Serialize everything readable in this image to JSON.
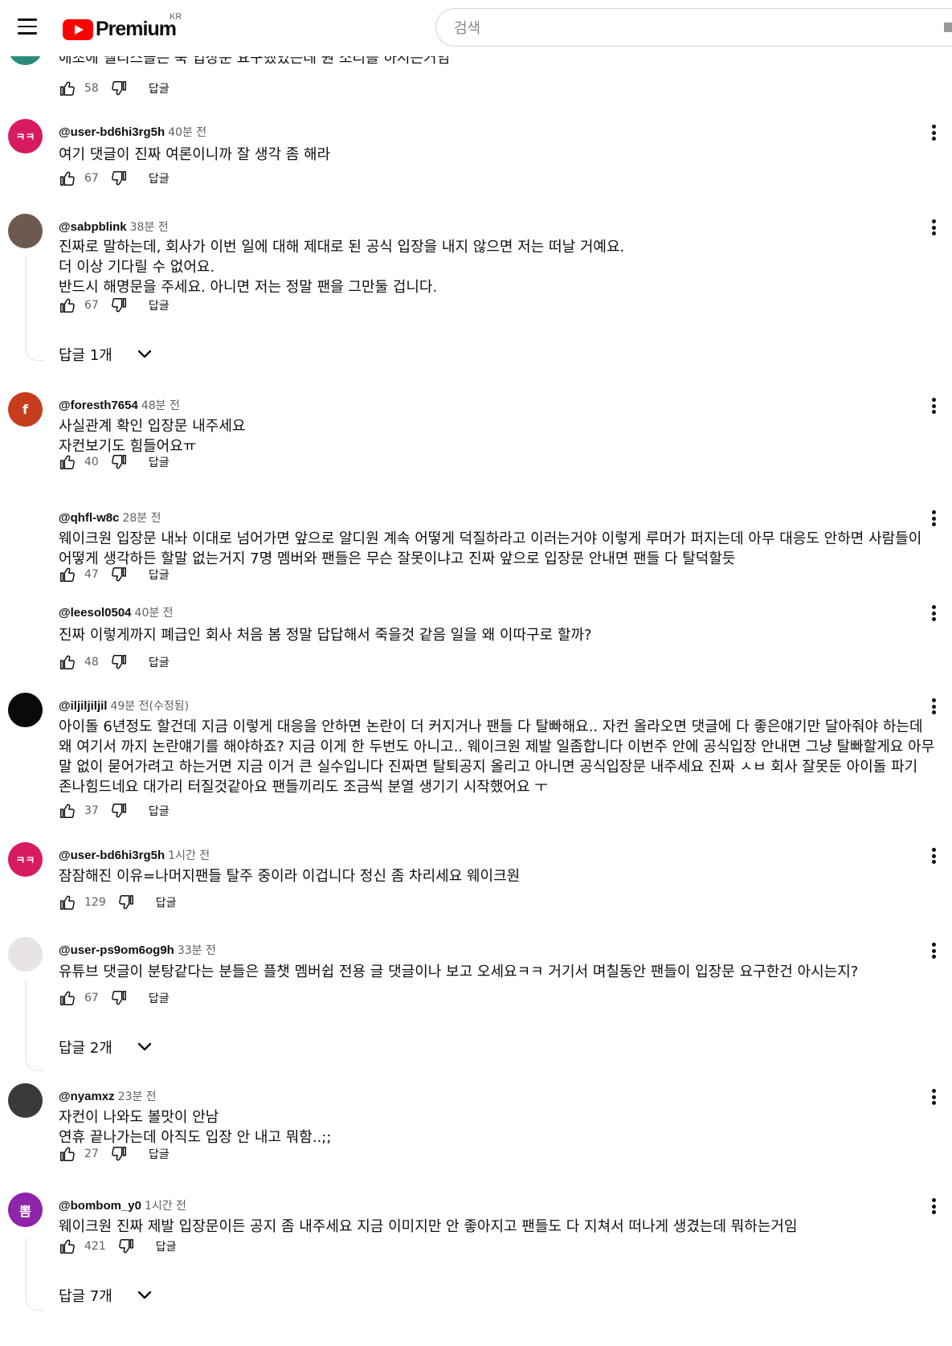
{
  "header": {
    "logo_text": "Premium",
    "region": "KR",
    "search_placeholder": "검색"
  },
  "reply_label": "답글",
  "top_partial": {
    "text": "애초에 멜리스들은 쭉 입장문 요구했었는데 뭔 소리를 하시는거임",
    "likes": "58"
  },
  "comments": [
    {
      "author": "@user-bd6hi3rg5h",
      "time": "40분 전",
      "avatar_text": "ㅋㅋ",
      "avatar_color": "#d81b60",
      "lines": [
        "여기 댓글이 진짜 여론이니까 잘 생각 좀 해라"
      ],
      "likes": "67"
    },
    {
      "author": "@sabpblink",
      "time": "38분 전",
      "avatar_text": "",
      "avatar_color": "#6d5a4e",
      "lines": [
        "진짜로 말하는데, 회사가 이번 일에 대해 제대로 된 공식 입장을 내지 않으면 저는 떠날 거예요.",
        "더 이상 기다릴 수 없어요.",
        "반드시 해명문을 주세요. 아니면 저는 정말 팬을 그만둘 겁니다."
      ],
      "likes": "67",
      "replies": "답글 1개"
    },
    {
      "author": "@foresth7654",
      "time": "48분 전",
      "avatar_text": "f",
      "avatar_color": "#c63d1e",
      "lines": [
        "사실관계 확인 입장문 내주세요",
        "자컨보기도 힘들어요ㅠ"
      ],
      "likes": "40"
    },
    {
      "author": "@qhfl-w8c",
      "time": "28분 전",
      "lines": [
        "웨이크원 입장문 내놔 이대로 넘어가면 앞으로 알디원 계속 어떻게 덕질하라고 이러는거야 이렇게 루머가 퍼지는데 아무 대응도 안하면 사람들이",
        "어떻게 생각하든 할말 없는거지 7명 멤버와 팬들은 무슨 잘못이냐고 진짜 앞으로 입장문 안내면 팬들 다 탈덕할듯"
      ],
      "likes": "47"
    },
    {
      "author": "@leesol0504",
      "time": "40분 전",
      "lines": [
        "진짜 이렇게까지 폐급인 회사 처음 봄 정말 답답해서 죽을것 같음 일을 왜 이따구로 할까?"
      ],
      "likes": "48"
    },
    {
      "author": "@iljiljiljil",
      "time": "49분 전(수정됨)",
      "avatar_text": "",
      "avatar_color": "#0a0a0a",
      "lines": [
        "아이돌 6년정도 할건데 지금 이렇게 대응을 안하면 논란이 더 커지거나 팬들 다 탈빠해요.. 자컨 올라오면 댓글에 다 좋은얘기만 달아줘야 하는데",
        "왜 여기서 까지 논란얘기를 해야하죠? 지금 이게 한 두번도 아니고.. 웨이크원 제발 일좀합니다 이번주 안에 공식입장 안내면 그냥 탈빠할게요 아무",
        "말 없이 묻어가려고 하는거면 지금 이거 큰 실수입니다 진짜면 탈퇴공지 올리고 아니면 공식입장문 내주세요 진짜 ㅅㅂ 회사 잘못둔 아이돌 파기",
        "존나힘드네요 대가리 터질것같아요 팬들끼리도 조금씩 분열 생기기 시작했어요 ㅜ"
      ],
      "likes": "37"
    },
    {
      "author": "@user-bd6hi3rg5h",
      "time": "1시간 전",
      "avatar_text": "ㅋㅋ",
      "avatar_color": "#d81b60",
      "lines": [
        "잠잠해진 이유=나머지팬들 탈주 중이라 이겁니다 정신 좀 차리세요 웨이크원"
      ],
      "likes": "129"
    },
    {
      "author": "@user-ps9om6og9h",
      "time": "33분 전",
      "avatar_text": "",
      "avatar_color": "#e8e4e4",
      "lines": [
        "유튜브 댓글이 분탕같다는 분들은 플챗 멤버쉽 전용 글 댓글이나 보고 오세요ㅋㅋ 거기서 며칠동안 팬들이 입장문 요구한건 아시는지?"
      ],
      "likes": "67",
      "replies": "답글 2개"
    },
    {
      "author": "@nyamxz",
      "time": "23분 전",
      "avatar_text": "",
      "avatar_color": "#3a3a3a",
      "lines": [
        "자컨이 나와도 볼맛이 안남",
        "연휴 끝나가는데 아직도 입장 안 내고 뭐함..;;"
      ],
      "likes": "27"
    },
    {
      "author": "@bombom_y0",
      "time": "1시간 전",
      "avatar_text": "뽐",
      "avatar_color": "#8e24aa",
      "lines": [
        "웨이크원 진짜 제발 입장문이든 공지 좀 내주세요 지금 이미지만 안 좋아지고 팬들도 다 지쳐서 떠나게 생겼는데 뭐하는거임"
      ],
      "likes": "421",
      "replies": "답글 7개"
    }
  ]
}
